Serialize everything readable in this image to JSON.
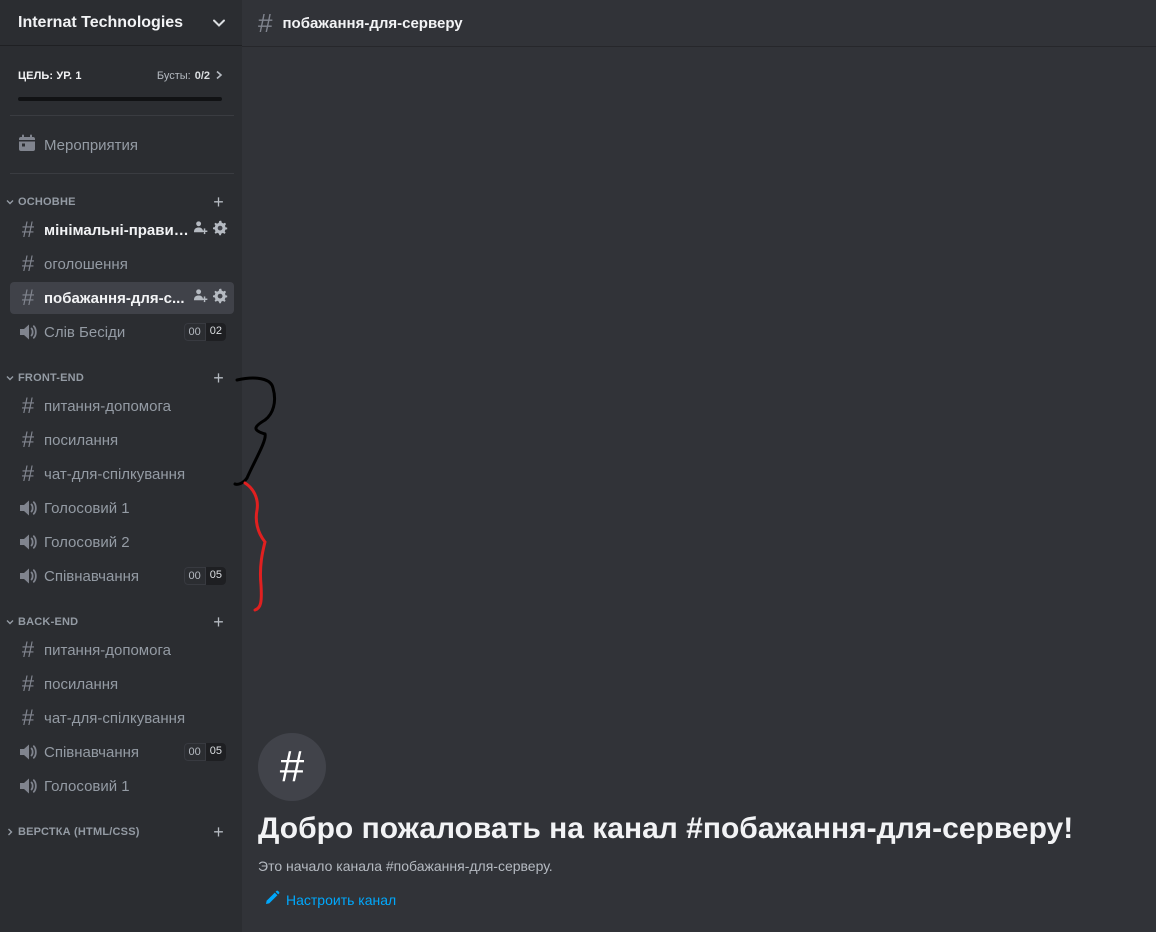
{
  "server": {
    "name": "Internat Technologies"
  },
  "boost": {
    "goal": "ЦЕЛЬ: УР. 1",
    "label": "Бусты:",
    "count": "0/2",
    "progress": 0
  },
  "events": {
    "label": "Мероприятия"
  },
  "categories": [
    {
      "name": "ОСНОВНЕ",
      "channels": [
        {
          "type": "text",
          "name": "мінімальні-правила",
          "state": "unread",
          "actions": true
        },
        {
          "type": "text",
          "name": "оголошення"
        },
        {
          "type": "text",
          "name": "побажання-для-с...",
          "state": "active",
          "actions": true
        },
        {
          "type": "voice",
          "name": "Слів Бесіди",
          "limit": [
            "00",
            "02"
          ]
        }
      ]
    },
    {
      "name": "FRONT-END",
      "channels": [
        {
          "type": "text",
          "name": "питання-допомога"
        },
        {
          "type": "text",
          "name": "посилання"
        },
        {
          "type": "text",
          "name": "чат-для-спілкування"
        },
        {
          "type": "voice",
          "name": "Голосовий 1"
        },
        {
          "type": "voice",
          "name": "Голосовий 2"
        },
        {
          "type": "voice",
          "name": "Співнавчання",
          "limit": [
            "00",
            "05"
          ]
        }
      ]
    },
    {
      "name": "BACK-END",
      "channels": [
        {
          "type": "text",
          "name": "питання-допомога"
        },
        {
          "type": "text",
          "name": "посилання"
        },
        {
          "type": "text",
          "name": "чат-для-спілкування"
        },
        {
          "type": "voice",
          "name": "Співнавчання",
          "limit": [
            "00",
            "05"
          ]
        },
        {
          "type": "voice",
          "name": "Голосовий 1"
        }
      ]
    },
    {
      "name": "ВЕРСТКА (HTML/CSS)",
      "collapsed": true,
      "channels": []
    }
  ],
  "channel_header": {
    "hash": "#",
    "title": "побажання-для-серверу"
  },
  "welcome": {
    "icon": "#",
    "title": "Добро пожаловать на канал #побажання-для-серверу!",
    "description": "Это начало канала #побажання-для-серверу.",
    "setup_label": "Настроить канал"
  },
  "colors": {
    "accent_link": "#00a8fc",
    "annotation_black": "#000000",
    "annotation_red": "#e02020"
  }
}
